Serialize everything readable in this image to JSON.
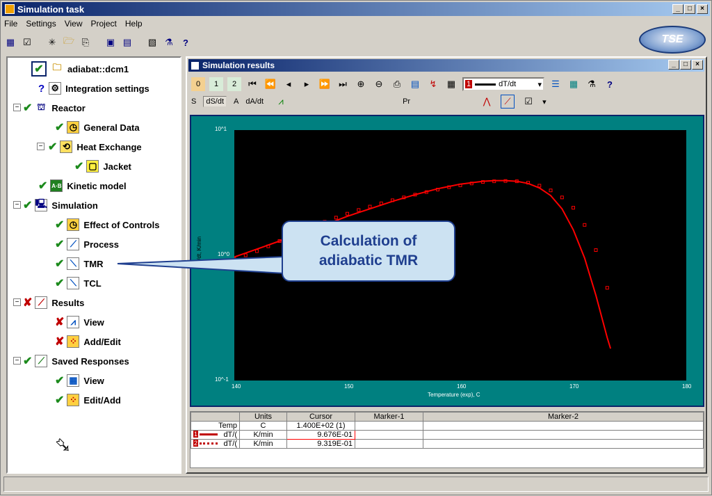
{
  "app": {
    "title": "Simulation task"
  },
  "menu": {
    "items": [
      "File",
      "Settings",
      "View",
      "Project",
      "Help"
    ]
  },
  "toolbar": {
    "icons": [
      "grid-icon",
      "check-icon",
      "new-icon",
      "open-icon",
      "copy-icon",
      "save-icon",
      "save-as-icon",
      "export-icon",
      "lab-icon",
      "help-icon"
    ],
    "help_label": "?"
  },
  "logo": {
    "text": "TSE"
  },
  "tree": {
    "root_label": "adiabat::dcm1",
    "items": [
      {
        "label": "Integration settings"
      },
      {
        "label": "Reactor"
      },
      {
        "label": "General Data"
      },
      {
        "label": "Heat Exchange"
      },
      {
        "label": "Jacket"
      },
      {
        "label": "Kinetic model"
      },
      {
        "label": "Simulation"
      },
      {
        "label": "Effect of Controls"
      },
      {
        "label": "Process"
      },
      {
        "label": "TMR"
      },
      {
        "label": "TCL"
      },
      {
        "label": "Results"
      },
      {
        "label": "View"
      },
      {
        "label": "Add/Edit"
      },
      {
        "label": "Saved Responses"
      },
      {
        "label": "View"
      },
      {
        "label": "Edit/Add"
      }
    ]
  },
  "results": {
    "title": "Simulation results",
    "tb_numbers": [
      "0",
      "1",
      "2"
    ],
    "dropdown": {
      "index": "1",
      "value": "dT/dt"
    },
    "tabs": [
      "S",
      "dS/dt",
      "A",
      "dA/dt"
    ],
    "pr_label": "Pr"
  },
  "callout": {
    "line1": "Calculation of",
    "line2": "adiabatic TMR"
  },
  "chart_data": {
    "type": "line",
    "xlabel": "Temperature (exp), C",
    "ylabel": "dT/dt, K/min",
    "xlim": [
      140,
      180
    ],
    "xticks": [
      "140",
      "150",
      "160",
      "170",
      "180"
    ],
    "yscale": "log",
    "ylim": [
      0.1,
      10
    ],
    "yticks": [
      "10^-1",
      "10^0",
      "10^1"
    ],
    "series": [
      {
        "color": "#ff0000",
        "style": "line",
        "x": [
          140,
          142,
          144,
          146,
          148,
          150,
          152,
          154,
          156,
          158,
          160,
          162,
          163,
          164,
          165,
          166,
          167,
          168,
          169,
          170,
          171,
          172,
          173,
          173.3
        ],
        "y": [
          0.97,
          1.12,
          1.3,
          1.5,
          1.75,
          2.05,
          2.35,
          2.7,
          3.05,
          3.4,
          3.7,
          3.9,
          3.95,
          3.95,
          3.9,
          3.75,
          3.45,
          3.0,
          2.35,
          1.6,
          0.95,
          0.48,
          0.22,
          0.18
        ]
      },
      {
        "color": "#ff0000",
        "style": "markers",
        "x": [
          140,
          141,
          142,
          143,
          144,
          145,
          146,
          147,
          148,
          149,
          150,
          151,
          152,
          153,
          154,
          155,
          156,
          157,
          158,
          159,
          160,
          161,
          162,
          163,
          164,
          165,
          166,
          167,
          168,
          169,
          170,
          171,
          172,
          173
        ],
        "y": [
          0.93,
          1.0,
          1.08,
          1.18,
          1.3,
          1.42,
          1.55,
          1.7,
          1.85,
          2.0,
          2.15,
          2.3,
          2.45,
          2.6,
          2.75,
          2.9,
          3.05,
          3.2,
          3.35,
          3.5,
          3.62,
          3.75,
          3.85,
          3.9,
          3.92,
          3.9,
          3.8,
          3.6,
          3.3,
          2.9,
          2.4,
          1.75,
          1.1,
          0.55
        ]
      }
    ]
  },
  "grid": {
    "headers": [
      "",
      "Units",
      "Cursor",
      "Marker-1",
      "Marker-2"
    ],
    "rows": [
      {
        "name": "Temp",
        "units": "C",
        "cursor": "1.400E+02 (1)",
        "m1": "",
        "m2": ""
      },
      {
        "index": "1",
        "name": "dT/(",
        "units": "K/min",
        "cursor": "9.676E-01",
        "m1": "",
        "m2": ""
      },
      {
        "index": "2",
        "name": "dT/(",
        "units": "K/min",
        "cursor": "9.319E-01",
        "m1": "",
        "m2": ""
      }
    ]
  }
}
